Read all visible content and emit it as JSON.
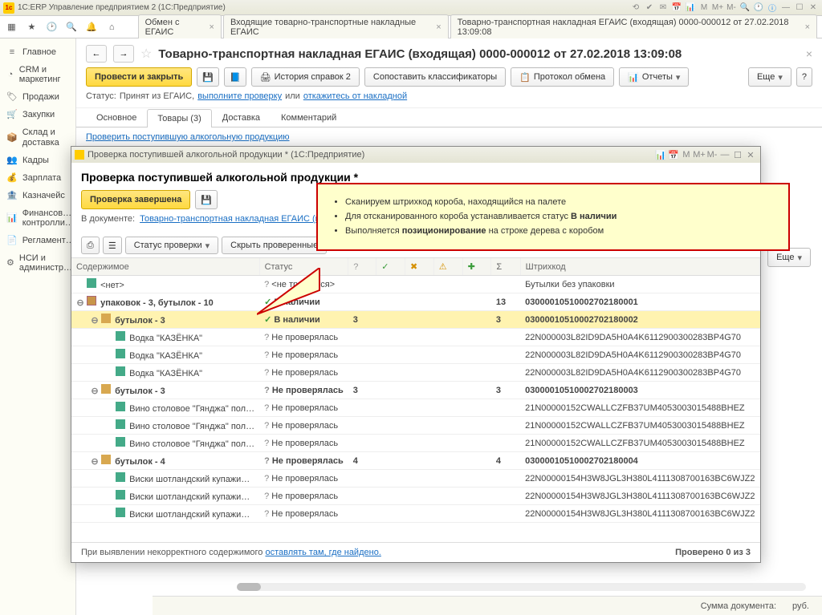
{
  "app": {
    "title": "1С:ERP Управление предприятием 2  (1С:Предприятие)"
  },
  "topTabs": [
    "Обмен с ЕГАИС",
    "Входящие товарно-транспортные накладные ЕГАИС",
    "Товарно-транспортная накладная ЕГАИС (входящая) 0000-000012 от 27.02.2018 13:09:08"
  ],
  "sidebar": [
    "Главное",
    "CRM и маркетинг",
    "Продажи",
    "Закупки",
    "Склад и доставка",
    "Кадры",
    "Зарплата",
    "Казначейс",
    "Финансов… контролли…",
    "Регламент…",
    "НСИ и администр…"
  ],
  "doc": {
    "title": "Товарно-транспортная накладная ЕГАИС (входящая) 0000-000012 от 27.02.2018 13:09:08",
    "btnPost": "Провести и закрыть",
    "btnHistory": "История справок 2",
    "btnMatch": "Сопоставить классификаторы",
    "btnProtocol": "Протокол обмена",
    "btnReports": "Отчеты",
    "btnMore": "Еще",
    "statusLabel": "Статус:",
    "statusText": "Принят из ЕГАИС,",
    "link1": "выполните проверку",
    "or": "или",
    "link2": "откажитесь от накладной",
    "tabs": [
      "Основное",
      "Товары (3)",
      "Доставка",
      "Комментарий"
    ],
    "checkLink": "Проверить поступившую алкогольную продукцию"
  },
  "dialog": {
    "title": "Проверка поступившей алкогольной продукции *  (1С:Предприятие)",
    "heading": "Проверка поступившей алкогольной продукции *",
    "btnDone": "Проверка завершена",
    "inDocLabel": "В документе:",
    "inDocLink": "Товарно-транспортная накладная ЕГАИС (входящая) 0000-00…",
    "ddStatus": "Статус проверки",
    "btnHide": "Скрыть проверенные",
    "btnMore": "Еще",
    "cols": {
      "content": "Содержимое",
      "status": "Статус",
      "barcode": "Штрихкод"
    },
    "rows": [
      {
        "indent": 0,
        "type": "bot",
        "name": "<нет>",
        "status": "<не требуется>",
        "statusClass": "q",
        "n1": "",
        "n2": "",
        "barcode": "Бутылки без упаковки"
      },
      {
        "indent": 0,
        "type": "pkg",
        "exp": "⊖",
        "name": "упаковок - 3, бутылок - 10",
        "status": "В наличии",
        "statusClass": "ok",
        "n1": "",
        "n2": "13",
        "barcode": "03000010510002702180001",
        "grp": true
      },
      {
        "indent": 1,
        "type": "box",
        "exp": "⊖",
        "name": "бутылок - 3",
        "status": "В наличии",
        "statusClass": "ok",
        "n1": "3",
        "n2": "3",
        "barcode": "03000010510002702180002",
        "sel": true,
        "grp": true
      },
      {
        "indent": 2,
        "type": "bot",
        "name": "Водка \"КАЗЁНКА\"",
        "status": "Не проверялась",
        "statusClass": "q",
        "barcode": "22N000003L82ID9DA5H0A4K6112900300283BP4G70"
      },
      {
        "indent": 2,
        "type": "bot",
        "name": "Водка \"КАЗЁНКА\"",
        "status": "Не проверялась",
        "statusClass": "q",
        "barcode": "22N000003L82ID9DA5H0A4K6112900300283BP4G70"
      },
      {
        "indent": 2,
        "type": "bot",
        "name": "Водка \"КАЗЁНКА\"",
        "status": "Не проверялась",
        "statusClass": "q",
        "barcode": "22N000003L82ID9DA5H0A4K6112900300283BP4G70"
      },
      {
        "indent": 1,
        "type": "box",
        "exp": "⊖",
        "name": "бутылок - 3",
        "status": "Не проверялась",
        "statusClass": "q",
        "n1": "3",
        "n2": "3",
        "barcode": "03000010510002702180003",
        "grp": true
      },
      {
        "indent": 2,
        "type": "bot",
        "name": "Вино столовое \"Гянджа\" пол…",
        "status": "Не проверялась",
        "statusClass": "q",
        "barcode": "21N00000152CWALLCZFB37UM4053003015488BHEZ"
      },
      {
        "indent": 2,
        "type": "bot",
        "name": "Вино столовое \"Гянджа\" пол…",
        "status": "Не проверялась",
        "statusClass": "q",
        "barcode": "21N00000152CWALLCZFB37UM4053003015488BHEZ"
      },
      {
        "indent": 2,
        "type": "bot",
        "name": "Вино столовое \"Гянджа\" пол…",
        "status": "Не проверялась",
        "statusClass": "q",
        "barcode": "21N00000152CWALLCZFB37UM4053003015488BHEZ"
      },
      {
        "indent": 1,
        "type": "box",
        "exp": "⊖",
        "name": "бутылок - 4",
        "status": "Не проверялась",
        "statusClass": "q",
        "n1": "4",
        "n2": "4",
        "barcode": "03000010510002702180004",
        "grp": true
      },
      {
        "indent": 2,
        "type": "bot",
        "name": "Виски шотландский купажи…",
        "status": "Не проверялась",
        "statusClass": "q",
        "barcode": "22N00000154H3W8JGL3H380L4111308700163BC6WJZ2"
      },
      {
        "indent": 2,
        "type": "bot",
        "name": "Виски шотландский купажи…",
        "status": "Не проверялась",
        "statusClass": "q",
        "barcode": "22N00000154H3W8JGL3H380L4111308700163BC6WJZ2"
      },
      {
        "indent": 2,
        "type": "bot",
        "name": "Виски шотландский купажи…",
        "status": "Не проверялась",
        "statusClass": "q",
        "barcode": "22N00000154H3W8JGL3H380L4111308700163BC6WJZ2"
      }
    ],
    "footerText": "При выявлении некорректного содержимого",
    "footerLink": "оставлять там, где найдено.",
    "footerCount": "Проверено 0 из 3"
  },
  "callout": {
    "l1a": "Сканируем штрихкод короба, находящийся на палете",
    "l2a": "Для отсканированного короба устанавливается статус ",
    "l2b": "В наличии",
    "l3a": "Выполняется ",
    "l3b": "позиционирование",
    "l3c": " на строке дерева с коробом"
  },
  "footer": {
    "sumLabel": "Сумма документа:",
    "cur": "руб."
  }
}
